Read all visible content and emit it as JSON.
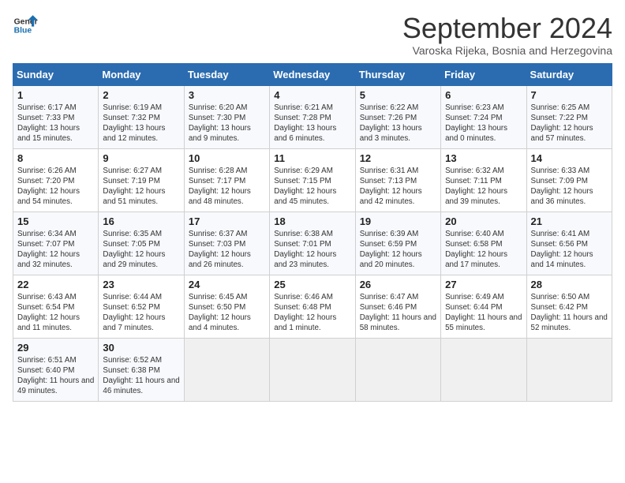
{
  "header": {
    "logo_line1": "General",
    "logo_line2": "Blue",
    "title": "September 2024",
    "subtitle": "Varoska Rijeka, Bosnia and Herzegovina"
  },
  "weekdays": [
    "Sunday",
    "Monday",
    "Tuesday",
    "Wednesday",
    "Thursday",
    "Friday",
    "Saturday"
  ],
  "weeks": [
    [
      {
        "day": "1",
        "sunrise": "Sunrise: 6:17 AM",
        "sunset": "Sunset: 7:33 PM",
        "daylight": "Daylight: 13 hours and 15 minutes."
      },
      {
        "day": "2",
        "sunrise": "Sunrise: 6:19 AM",
        "sunset": "Sunset: 7:32 PM",
        "daylight": "Daylight: 13 hours and 12 minutes."
      },
      {
        "day": "3",
        "sunrise": "Sunrise: 6:20 AM",
        "sunset": "Sunset: 7:30 PM",
        "daylight": "Daylight: 13 hours and 9 minutes."
      },
      {
        "day": "4",
        "sunrise": "Sunrise: 6:21 AM",
        "sunset": "Sunset: 7:28 PM",
        "daylight": "Daylight: 13 hours and 6 minutes."
      },
      {
        "day": "5",
        "sunrise": "Sunrise: 6:22 AM",
        "sunset": "Sunset: 7:26 PM",
        "daylight": "Daylight: 13 hours and 3 minutes."
      },
      {
        "day": "6",
        "sunrise": "Sunrise: 6:23 AM",
        "sunset": "Sunset: 7:24 PM",
        "daylight": "Daylight: 13 hours and 0 minutes."
      },
      {
        "day": "7",
        "sunrise": "Sunrise: 6:25 AM",
        "sunset": "Sunset: 7:22 PM",
        "daylight": "Daylight: 12 hours and 57 minutes."
      }
    ],
    [
      {
        "day": "8",
        "sunrise": "Sunrise: 6:26 AM",
        "sunset": "Sunset: 7:20 PM",
        "daylight": "Daylight: 12 hours and 54 minutes."
      },
      {
        "day": "9",
        "sunrise": "Sunrise: 6:27 AM",
        "sunset": "Sunset: 7:19 PM",
        "daylight": "Daylight: 12 hours and 51 minutes."
      },
      {
        "day": "10",
        "sunrise": "Sunrise: 6:28 AM",
        "sunset": "Sunset: 7:17 PM",
        "daylight": "Daylight: 12 hours and 48 minutes."
      },
      {
        "day": "11",
        "sunrise": "Sunrise: 6:29 AM",
        "sunset": "Sunset: 7:15 PM",
        "daylight": "Daylight: 12 hours and 45 minutes."
      },
      {
        "day": "12",
        "sunrise": "Sunrise: 6:31 AM",
        "sunset": "Sunset: 7:13 PM",
        "daylight": "Daylight: 12 hours and 42 minutes."
      },
      {
        "day": "13",
        "sunrise": "Sunrise: 6:32 AM",
        "sunset": "Sunset: 7:11 PM",
        "daylight": "Daylight: 12 hours and 39 minutes."
      },
      {
        "day": "14",
        "sunrise": "Sunrise: 6:33 AM",
        "sunset": "Sunset: 7:09 PM",
        "daylight": "Daylight: 12 hours and 36 minutes."
      }
    ],
    [
      {
        "day": "15",
        "sunrise": "Sunrise: 6:34 AM",
        "sunset": "Sunset: 7:07 PM",
        "daylight": "Daylight: 12 hours and 32 minutes."
      },
      {
        "day": "16",
        "sunrise": "Sunrise: 6:35 AM",
        "sunset": "Sunset: 7:05 PM",
        "daylight": "Daylight: 12 hours and 29 minutes."
      },
      {
        "day": "17",
        "sunrise": "Sunrise: 6:37 AM",
        "sunset": "Sunset: 7:03 PM",
        "daylight": "Daylight: 12 hours and 26 minutes."
      },
      {
        "day": "18",
        "sunrise": "Sunrise: 6:38 AM",
        "sunset": "Sunset: 7:01 PM",
        "daylight": "Daylight: 12 hours and 23 minutes."
      },
      {
        "day": "19",
        "sunrise": "Sunrise: 6:39 AM",
        "sunset": "Sunset: 6:59 PM",
        "daylight": "Daylight: 12 hours and 20 minutes."
      },
      {
        "day": "20",
        "sunrise": "Sunrise: 6:40 AM",
        "sunset": "Sunset: 6:58 PM",
        "daylight": "Daylight: 12 hours and 17 minutes."
      },
      {
        "day": "21",
        "sunrise": "Sunrise: 6:41 AM",
        "sunset": "Sunset: 6:56 PM",
        "daylight": "Daylight: 12 hours and 14 minutes."
      }
    ],
    [
      {
        "day": "22",
        "sunrise": "Sunrise: 6:43 AM",
        "sunset": "Sunset: 6:54 PM",
        "daylight": "Daylight: 12 hours and 11 minutes."
      },
      {
        "day": "23",
        "sunrise": "Sunrise: 6:44 AM",
        "sunset": "Sunset: 6:52 PM",
        "daylight": "Daylight: 12 hours and 7 minutes."
      },
      {
        "day": "24",
        "sunrise": "Sunrise: 6:45 AM",
        "sunset": "Sunset: 6:50 PM",
        "daylight": "Daylight: 12 hours and 4 minutes."
      },
      {
        "day": "25",
        "sunrise": "Sunrise: 6:46 AM",
        "sunset": "Sunset: 6:48 PM",
        "daylight": "Daylight: 12 hours and 1 minute."
      },
      {
        "day": "26",
        "sunrise": "Sunrise: 6:47 AM",
        "sunset": "Sunset: 6:46 PM",
        "daylight": "Daylight: 11 hours and 58 minutes."
      },
      {
        "day": "27",
        "sunrise": "Sunrise: 6:49 AM",
        "sunset": "Sunset: 6:44 PM",
        "daylight": "Daylight: 11 hours and 55 minutes."
      },
      {
        "day": "28",
        "sunrise": "Sunrise: 6:50 AM",
        "sunset": "Sunset: 6:42 PM",
        "daylight": "Daylight: 11 hours and 52 minutes."
      }
    ],
    [
      {
        "day": "29",
        "sunrise": "Sunrise: 6:51 AM",
        "sunset": "Sunset: 6:40 PM",
        "daylight": "Daylight: 11 hours and 49 minutes."
      },
      {
        "day": "30",
        "sunrise": "Sunrise: 6:52 AM",
        "sunset": "Sunset: 6:38 PM",
        "daylight": "Daylight: 11 hours and 46 minutes."
      },
      null,
      null,
      null,
      null,
      null
    ]
  ]
}
